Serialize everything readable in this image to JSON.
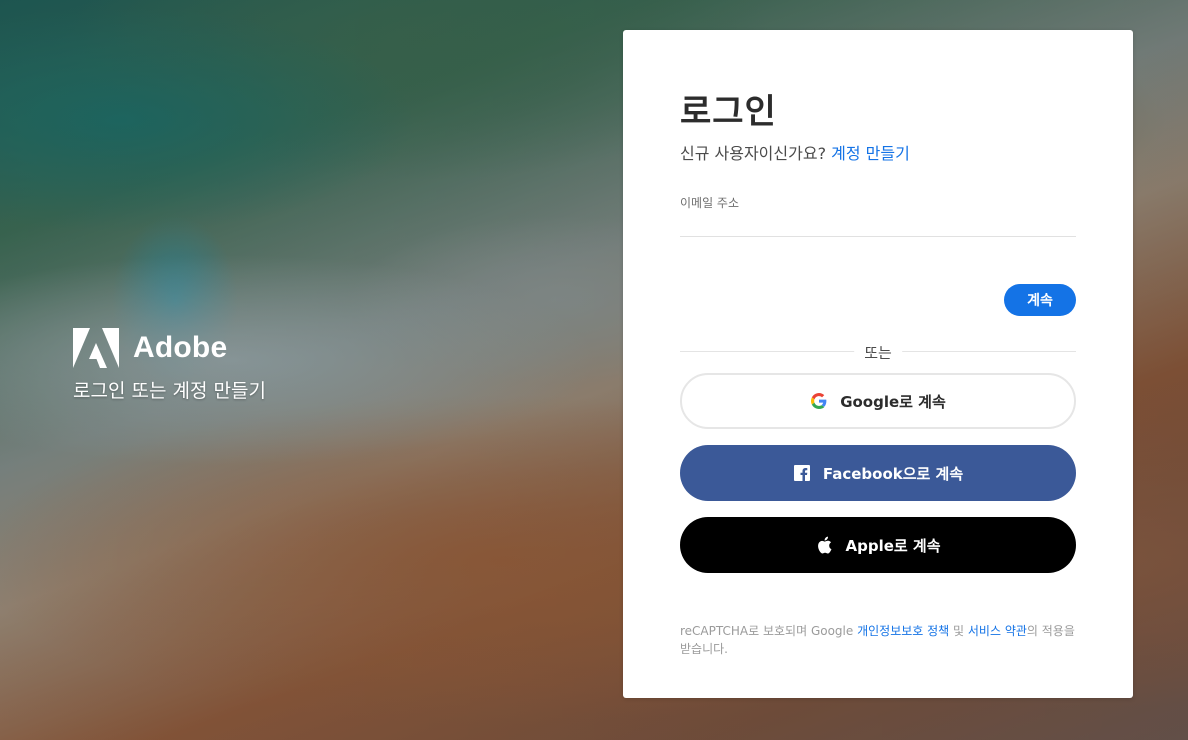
{
  "brand": {
    "name": "Adobe",
    "tagline": "로그인 또는 계정 만들기"
  },
  "card": {
    "title": "로그인",
    "subtitle_prefix": "신규 사용자이신가요?",
    "create_account_link": "계정 만들기",
    "email_label": "이메일 주소",
    "email_value": "",
    "continue_button": "계속",
    "divider_text": "또는",
    "social": {
      "google": "Google로 계속",
      "facebook": "Facebook으로 계속",
      "apple": "Apple로 계속"
    },
    "legal": {
      "prefix": "reCAPTCHA로 보호되며 Google ",
      "privacy_link": "개인정보보호 정책",
      "and": " 및 ",
      "terms_link": "서비스 약관",
      "suffix": "의 적용을 받습니다."
    }
  },
  "colors": {
    "accent": "#1473e6",
    "facebook": "#3b5998",
    "apple": "#000000"
  },
  "icons": [
    "adobe-logo-icon",
    "google-icon",
    "facebook-icon",
    "apple-icon"
  ]
}
